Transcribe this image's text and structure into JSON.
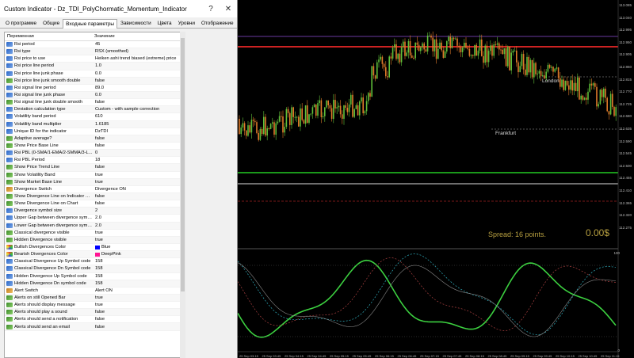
{
  "dialog": {
    "title": "Custom Indicator - Dz_TDI_PolyChormatic_Momentum_Indicator",
    "help_label": "?",
    "close_label": "✕",
    "tabs": [
      "О программе",
      "Общие",
      "Входные параметры",
      "Зависимости",
      "Цвета",
      "Уровни",
      "Отображение"
    ],
    "active_tab": 2,
    "columns": {
      "name": "Переменная",
      "value": "Значение"
    },
    "rows": [
      {
        "icon": "ab",
        "name": "Rsi period",
        "value": "45"
      },
      {
        "icon": "ab",
        "name": "Rsi type",
        "value": "RSX (smoothed)"
      },
      {
        "icon": "ab",
        "name": "Rsi price to use",
        "value": "Heiken ashi trend biased (extreme) price"
      },
      {
        "icon": "ab",
        "name": "Rsi price line period",
        "value": "1.0"
      },
      {
        "icon": "ab",
        "name": "Rsi price line junk phase",
        "value": "0.0"
      },
      {
        "icon": "n1",
        "name": "Rsi price line junk smooth double",
        "value": "false"
      },
      {
        "icon": "ab",
        "name": "Rsi signal line period",
        "value": "89.0"
      },
      {
        "icon": "ab",
        "name": "Rsi signal line junk phase",
        "value": "0.0"
      },
      {
        "icon": "n1",
        "name": "Rsi signal line junk double smooth",
        "value": "false"
      },
      {
        "icon": "ab",
        "name": "Deviation calculation type",
        "value": "Custom - with sample correction"
      },
      {
        "icon": "ab",
        "name": "Volatility band period",
        "value": "610"
      },
      {
        "icon": "ab",
        "name": "Volatility band multiplier",
        "value": "1.6185"
      },
      {
        "icon": "ab",
        "name": "Unique ID for the indicator",
        "value": "DzTDI"
      },
      {
        "icon": "n1",
        "name": "Adaptive average?",
        "value": "false"
      },
      {
        "icon": "n1",
        "name": "Show Price Base Line",
        "value": "false"
      },
      {
        "icon": "ab",
        "name": "Rsi PBL (0-SMA/1-EMA/2-SMMA/3-L...",
        "value": "0"
      },
      {
        "icon": "ab",
        "name": "Rsi PBL Period",
        "value": "18"
      },
      {
        "icon": "n1",
        "name": "Show Price Trend Line",
        "value": "false"
      },
      {
        "icon": "n1",
        "name": "Show Volatility Band",
        "value": "true"
      },
      {
        "icon": "n1",
        "name": "Show Market Base Line",
        "value": "true"
      },
      {
        "icon": "en",
        "name": "Divergence Switch",
        "value": "Divergence ON"
      },
      {
        "icon": "n1",
        "name": "Show Divergence Line on Indicator Wi...",
        "value": "false"
      },
      {
        "icon": "n1",
        "name": "Show Divergence Line on Chart",
        "value": "false"
      },
      {
        "icon": "ab",
        "name": "Divergence symbol size",
        "value": "2"
      },
      {
        "icon": "ab",
        "name": "Upper Gap between divergence symb...",
        "value": "2.0"
      },
      {
        "icon": "ab",
        "name": "Lower Gap between divergence symb...",
        "value": "2.0"
      },
      {
        "icon": "n1",
        "name": "Classical divergence visible",
        "value": "true"
      },
      {
        "icon": "n1",
        "name": "Hidden Divergence visible",
        "value": "true"
      },
      {
        "icon": "co",
        "name": "Bullish Divergences Color",
        "value": "Blue",
        "swatch": "#0000ff"
      },
      {
        "icon": "co",
        "name": "Bearish Divergences Color",
        "value": "DeepPink",
        "swatch": "#ff1493"
      },
      {
        "icon": "ab",
        "name": "Classical Divergence Up Symbol code",
        "value": "158"
      },
      {
        "icon": "ab",
        "name": "Classical Divergence Dn Symbol code",
        "value": "158"
      },
      {
        "icon": "ab",
        "name": "Hidden Divergence Up Symbol code",
        "value": "158"
      },
      {
        "icon": "ab",
        "name": "Hidden Divergence Dn symbol code",
        "value": "158"
      },
      {
        "icon": "en",
        "name": "Alert Switch",
        "value": "Alert ON"
      },
      {
        "icon": "n1",
        "name": "Alerts on still Opened Bar",
        "value": "true"
      },
      {
        "icon": "n1",
        "name": "Alerts should display message",
        "value": "true"
      },
      {
        "icon": "n1",
        "name": "Alerts should play a sound",
        "value": "false"
      },
      {
        "icon": "n1",
        "name": "Alerts should send a notification",
        "value": "false"
      },
      {
        "icon": "n1",
        "name": "Alerts should send an email",
        "value": "false"
      }
    ]
  },
  "chart": {
    "price_labels": [
      "113.085",
      "113.040",
      "112.995",
      "112.950",
      "112.905",
      "112.860",
      "112.815",
      "112.770",
      "112.725",
      "112.680",
      "112.635",
      "112.590",
      "112.545",
      "112.500",
      "112.455",
      "112.410",
      "112.365",
      "112.320",
      "112.275"
    ],
    "time_labels": [
      "25 Sep 03:15",
      "25 Sep 03:45",
      "25 Sep 04:15",
      "25 Sep 04:45",
      "25 Sep 05:15",
      "25 Sep 05:45",
      "25 Sep 06:15",
      "25 Sep 06:45",
      "25 Sep 07:15",
      "25 Sep 07:45",
      "25 Sep 08:15",
      "25 Sep 08:45",
      "25 Sep 09:15",
      "25 Sep 09:45",
      "25 Sep 10:15",
      "25 Sep 10:45",
      "25 Sep 11:15"
    ],
    "sessions": {
      "frankfurt": "Frankfurt",
      "london": "London"
    },
    "spread_text": "Spread: 16 points.",
    "profit_text": "0.00$",
    "indicator_labels": [
      "100",
      "0"
    ],
    "colors": {
      "bull": "#5fbf3a",
      "bear": "#e07a2a",
      "green_line": "#22cc22",
      "red_line": "#cc2222",
      "purple_line": "#6a3aa0"
    }
  }
}
